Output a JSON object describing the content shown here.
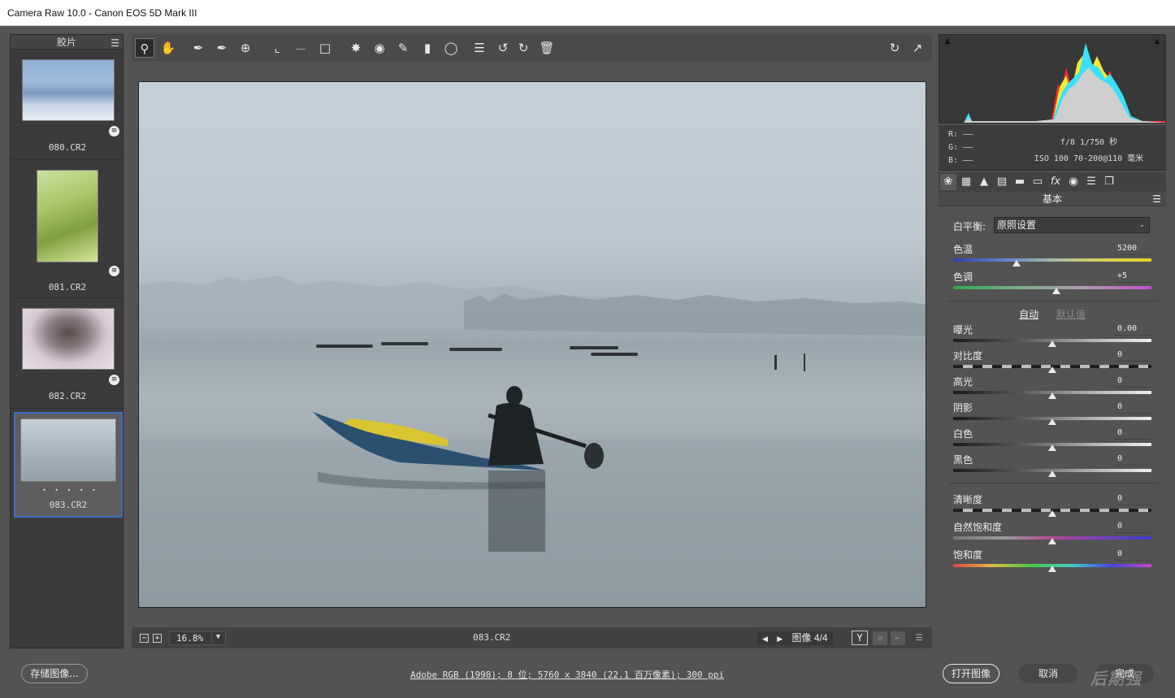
{
  "window": {
    "title": "Camera Raw 10.0 -  Canon EOS 5D Mark III"
  },
  "filmstrip": {
    "header": "胶片",
    "menu_icon": "☰",
    "items": [
      {
        "name": "080.CR2"
      },
      {
        "name": "081.CR2"
      },
      {
        "name": "082.CR2"
      },
      {
        "name": "083.CR2",
        "rating_dots": "• • • • •"
      }
    ]
  },
  "toolbar": {
    "tools": [
      "zoom-icon",
      "hand-icon",
      "white-balance-icon",
      "color-sampler-icon",
      "target-adjust-icon",
      "crop-icon",
      "straighten-icon",
      "transform-icon",
      "spot-removal-icon",
      "red-eye-icon",
      "adjustment-brush-icon",
      "graduated-filter-icon",
      "radial-filter-icon",
      "preferences-icon",
      "rotate-left-icon",
      "rotate-right-icon",
      "trash-icon"
    ],
    "right": [
      "cycle-icon",
      "fullscreen-icon"
    ]
  },
  "preview": {
    "zoom_minus": "−",
    "zoom_plus": "+",
    "zoom": "16.8%",
    "filename": "083.CR2",
    "nav_prev": "◀",
    "nav_next": "▶",
    "image_label": "图像 4/4",
    "y_button": "Y"
  },
  "histogram": {
    "clip_shadow": "▲",
    "clip_highlight": "▲"
  },
  "info": {
    "r": "R:  ——",
    "g": "G:  ——",
    "b": "B:  ——",
    "aperture_shutter": "f/8  1/750 秒",
    "iso_lens": "ISO 100  70-200@110 毫米"
  },
  "panel": {
    "title": "基本",
    "menu_icon": "☰",
    "wb_label": "白平衡:",
    "wb_value": "原照设置",
    "wb_chevron": "⌄",
    "auto": "自动",
    "default": "默认值",
    "sliders": [
      {
        "label": "色温",
        "value": "5200",
        "pos": 0.32
      },
      {
        "label": "色调",
        "value": "+5",
        "pos": 0.52
      },
      {
        "label": "曝光",
        "value": "0.00",
        "pos": 0.5
      },
      {
        "label": "对比度",
        "value": "0",
        "pos": 0.5
      },
      {
        "label": "高光",
        "value": "0",
        "pos": 0.5
      },
      {
        "label": "阴影",
        "value": "0",
        "pos": 0.5
      },
      {
        "label": "白色",
        "value": "0",
        "pos": 0.5
      },
      {
        "label": "黑色",
        "value": "0",
        "pos": 0.5
      },
      {
        "label": "清晰度",
        "value": "0",
        "pos": 0.5
      },
      {
        "label": "自然饱和度",
        "value": "0",
        "pos": 0.5
      },
      {
        "label": "饱和度",
        "value": "0",
        "pos": 0.5
      }
    ]
  },
  "bottom": {
    "save": "存储图像...",
    "workflow": "Adobe RGB (1998); 8 位; 5760 x 3840 (22.1 百万像素); 300 ppi",
    "open": "打开图像",
    "cancel": "取消",
    "done": "完成",
    "watermark": "后期强"
  }
}
